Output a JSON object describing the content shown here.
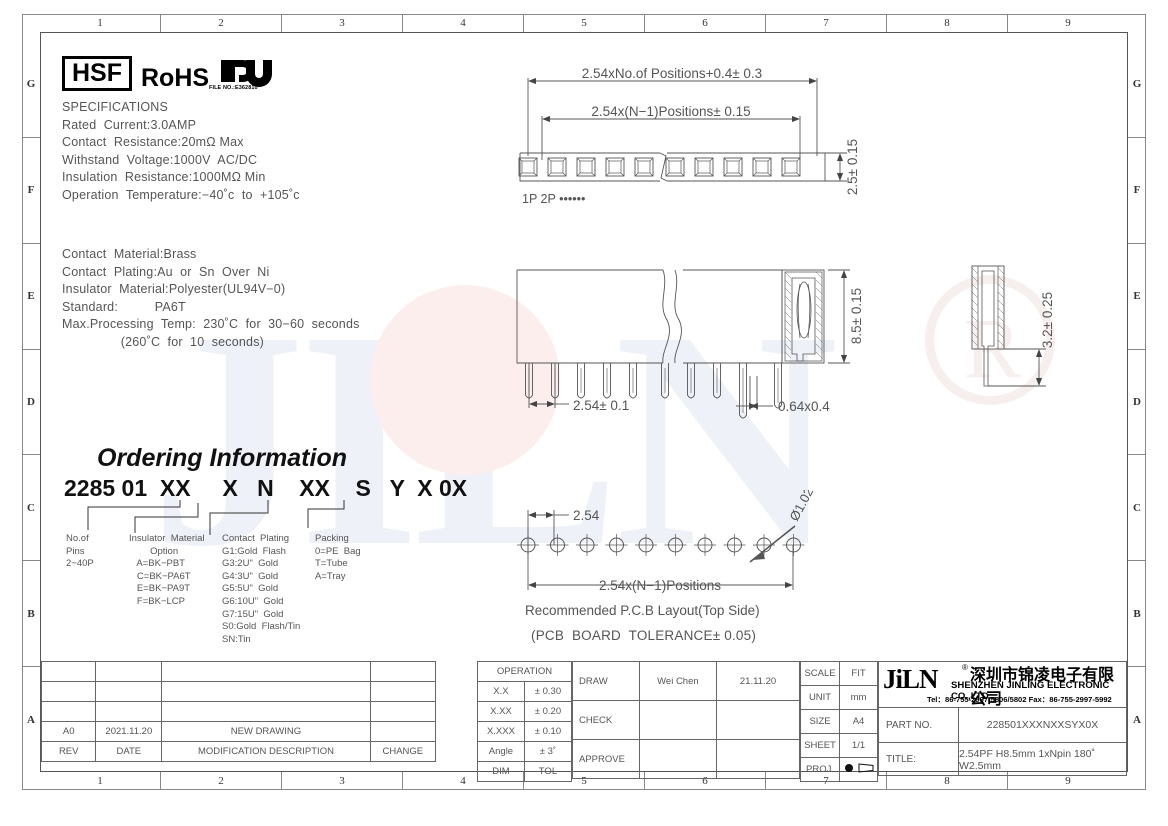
{
  "frame": {
    "zones_horizontal": [
      "1",
      "2",
      "3",
      "4",
      "5",
      "6",
      "7",
      "8",
      "9"
    ],
    "zones_vertical": [
      "G",
      "F",
      "E",
      "D",
      "C",
      "B",
      "A"
    ]
  },
  "compliance": {
    "hsf": "HSF",
    "rohs": "RoHS",
    "ul_icon": "ul-mark-icon",
    "ul_file": "FILE NO.:E362810"
  },
  "specifications": {
    "heading": "SPECIFICATIONS",
    "lines": [
      "Rated  Current:3.0AMP",
      "Contact  Resistance:20mΩ Max",
      "Withstand  Voltage:1000V  AC/DC",
      "Insulation  Resistance:1000MΩ Min",
      "Operation  Temperature:−40˚c  to  +105˚c"
    ],
    "materials": [
      "Contact  Material:Brass",
      "Contact  Plating:Au  or  Sn  Over  Ni",
      "Insulator  Material:Polyester(UL94V−0)",
      "Standard:          PA6T",
      "Max.Processing  Temp:  230˚C  for  30−60  seconds",
      "                (260˚C  for  10  seconds)"
    ]
  },
  "ordering": {
    "title": "Ordering Information",
    "code": "2285 01  XX     X   N    XX    S   Y  X 0X",
    "legend": {
      "pins": "No.of\nPins\n2−40P",
      "insulator": "Insulator  Material\n        Option\n   A=BK−PBT\n   C=BK−PA6T\n   E=BK−PA9T\n   F=BK−LCP",
      "plating": "Contact  Plating\nG1:Gold  Flash\nG3:2Uʺ  Gold\nG4:3Uʺ  Gold\nG5:5Uʺ  Gold\nG6:10Uʺ  Gold\nG7:15Uʺ  Gold\nS0:Gold  Flash/Tin\nSN:Tin",
      "packing": "Packing\n0=PE  Bag\nT=Tube\nA=Tray"
    }
  },
  "drawings": {
    "top_view": {
      "dim_overall": "2.54xNo.of  Positions+0.4± 0.3",
      "dim_pitch_total": "2.54x(N−1)Positions± 0.15",
      "dim_height": "2.5± 0.15",
      "pin_labels": "1P  2P  ••••••"
    },
    "side_view": {
      "dim_height": "8.5± 0.15",
      "dim_pitch": "2.54± 0.1",
      "dim_pin": "0.64x0.4"
    },
    "end_view": {
      "dim_tail": "3.2± 0.25"
    },
    "pcb_layout": {
      "dim_pitch": "2.54",
      "dim_span": "2.54x(N−1)Positions",
      "dim_hole": "Ø1.02",
      "caption1": "Recommended  P.C.B  Layout(Top  Side)",
      "caption2": "(PCB  BOARD  TOLERANCE± 0.05)"
    }
  },
  "revision_table": {
    "headers": [
      "REV",
      "DATE",
      "MODIFICATION  DESCRIPTION",
      "CHANGE"
    ],
    "rows": [
      [
        "A0",
        "2021.11.20",
        "NEW  DRAWING",
        ""
      ],
      [
        "",
        "",
        "",
        ""
      ],
      [
        "",
        "",
        "",
        ""
      ],
      [
        "",
        "",
        "",
        ""
      ]
    ]
  },
  "tolerance_table": {
    "header": "OPERATION",
    "rows": [
      [
        "X.X",
        "± 0.30"
      ],
      [
        "X.XX",
        "± 0.20"
      ],
      [
        "X.XXX",
        "± 0.10"
      ],
      [
        "Angle",
        "± 3˚"
      ],
      [
        "DIM",
        "TOL"
      ]
    ]
  },
  "signoff": {
    "draw_label": "DRAW",
    "draw_name": "Wei  Chen",
    "draw_date": "21.11.20",
    "check_label": "CHECK",
    "check_name": "",
    "check_date": "",
    "approve_label": "APPROVE",
    "approve_name": "",
    "approve_date": ""
  },
  "meta_table": {
    "scale_label": "SCALE",
    "scale_value": "FIT",
    "unit_label": "UNIT",
    "unit_value": "mm",
    "size_label": "SIZE",
    "size_value": "A4",
    "sheet_label": "SHEET",
    "sheet_value": "1/1",
    "proj_label": "PROJ.",
    "proj_value": "first-angle-projection-icon"
  },
  "company": {
    "logo": "JiLN",
    "registered": "®",
    "name_cn": "深圳市锦凌电子有限公司",
    "name_en": "SHENZHEN JINLING ELECTRONIC CO.,LTD",
    "contact": "Tel：86-755-2997-5806/5802    Fax：86-755-2997-5992",
    "part_no_label": "PART  NO.",
    "part_no_value": "228501XXXNXXSYX0X",
    "title_label": "TITLE:",
    "title_value": "2.54PF  H8.5mm  1xNpin  180˚  W2.5mm"
  },
  "colors": {
    "line": "#555555",
    "frame": "#888888",
    "text": "#555555",
    "black": "#111111",
    "watermark_blue": "#eef1f8",
    "watermark_pink": "#fdeeee"
  }
}
